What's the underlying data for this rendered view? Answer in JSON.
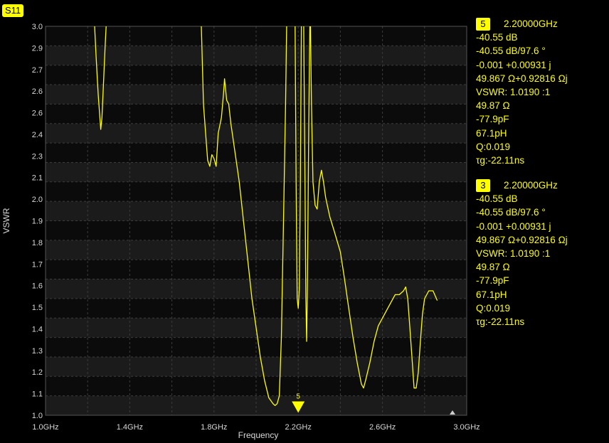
{
  "trace_label": "S11",
  "colors": {
    "trace": "#ffff00",
    "band_light": "#1b1b1b",
    "band_dark": "#0b0b0b",
    "grid": "#3c3c3c",
    "axis_text": "#d8d8d8"
  },
  "chart_data": {
    "type": "line",
    "title": "",
    "xlabel": "Frequency",
    "ylabel": "VSWR",
    "xlim": [
      1.0,
      3.0
    ],
    "ylim": [
      1.0,
      3.0
    ],
    "x_ticks": [
      {
        "v": 1.0,
        "label": "1.0GHz"
      },
      {
        "v": 1.4,
        "label": "1.4GHz"
      },
      {
        "v": 1.8,
        "label": "1.8GHz"
      },
      {
        "v": 2.2,
        "label": "2.2GHz"
      },
      {
        "v": 2.6,
        "label": "2.6GHz"
      },
      {
        "v": 3.0,
        "label": "3.0GHz"
      }
    ],
    "y_ticks": [
      {
        "v": 1.0,
        "label": "1.0"
      },
      {
        "v": 1.1,
        "label": "1.1"
      },
      {
        "v": 1.2,
        "label": "1.2"
      },
      {
        "v": 1.3,
        "label": "1.3"
      },
      {
        "v": 1.4,
        "label": "1.4"
      },
      {
        "v": 1.5,
        "label": "1.5"
      },
      {
        "v": 1.6,
        "label": "1.6"
      },
      {
        "v": 1.7,
        "label": "1.7"
      },
      {
        "v": 1.8,
        "label": "1.8"
      },
      {
        "v": 1.9,
        "label": "1.9"
      },
      {
        "v": 2.0,
        "label": "2.0"
      },
      {
        "v": 2.1,
        "label": "2.1"
      },
      {
        "v": 2.2,
        "label": "2.3"
      },
      {
        "v": 2.3,
        "label": "2.4"
      },
      {
        "v": 2.4,
        "label": "2.6"
      },
      {
        "v": 2.5,
        "label": "2.6"
      },
      {
        "v": 2.6,
        "label": "2.7"
      },
      {
        "v": 2.7,
        "label": "2.9"
      },
      {
        "v": 2.8,
        "label": "3.0"
      }
    ],
    "grid": true,
    "series": [
      {
        "segments": [
          [
            [
              1.233,
              3.0
            ],
            [
              1.24,
              2.85
            ],
            [
              1.25,
              2.65
            ],
            [
              1.258,
              2.53
            ],
            [
              1.262,
              2.47
            ],
            [
              1.268,
              2.53
            ],
            [
              1.275,
              2.7
            ],
            [
              1.283,
              2.9
            ],
            [
              1.288,
              3.0
            ]
          ],
          [
            [
              1.74,
              3.0
            ],
            [
              1.745,
              2.8
            ],
            [
              1.75,
              2.6
            ],
            [
              1.76,
              2.45
            ],
            [
              1.77,
              2.31
            ],
            [
              1.78,
              2.28
            ],
            [
              1.79,
              2.34
            ],
            [
              1.8,
              2.32
            ],
            [
              1.81,
              2.28
            ],
            [
              1.82,
              2.45
            ],
            [
              1.835,
              2.53
            ],
            [
              1.845,
              2.65
            ],
            [
              1.85,
              2.73
            ],
            [
              1.86,
              2.62
            ],
            [
              1.87,
              2.6
            ],
            [
              1.88,
              2.5
            ],
            [
              1.9,
              2.35
            ],
            [
              1.92,
              2.2
            ],
            [
              1.94,
              2.0
            ],
            [
              1.96,
              1.8
            ],
            [
              1.98,
              1.6
            ],
            [
              2.0,
              1.45
            ],
            [
              2.02,
              1.3
            ],
            [
              2.04,
              1.18
            ],
            [
              2.06,
              1.09
            ],
            [
              2.08,
              1.06
            ],
            [
              2.09,
              1.05
            ],
            [
              2.1,
              1.06
            ],
            [
              2.11,
              1.1
            ],
            [
              2.12,
              1.4
            ],
            [
              2.13,
              2.0
            ],
            [
              2.14,
              2.6
            ],
            [
              2.145,
              3.0
            ]
          ],
          [
            [
              2.185,
              3.0
            ],
            [
              2.19,
              2.2
            ],
            [
              2.195,
              1.6
            ],
            [
              2.2,
              1.55
            ],
            [
              2.205,
              1.65
            ],
            [
              2.21,
              2.2
            ],
            [
              2.215,
              3.0
            ]
          ],
          [
            [
              2.226,
              3.0
            ],
            [
              2.232,
              2.2
            ],
            [
              2.236,
              1.6
            ],
            [
              2.24,
              1.38
            ],
            [
              2.244,
              1.7
            ],
            [
              2.25,
              2.5
            ],
            [
              2.255,
              3.0
            ]
          ],
          [
            [
              2.258,
              3.0
            ],
            [
              2.263,
              2.6
            ],
            [
              2.27,
              2.2
            ],
            [
              2.28,
              2.08
            ],
            [
              2.29,
              2.06
            ],
            [
              2.3,
              2.2
            ],
            [
              2.31,
              2.26
            ],
            [
              2.32,
              2.2
            ],
            [
              2.33,
              2.12
            ],
            [
              2.35,
              2.02
            ],
            [
              2.37,
              1.95
            ],
            [
              2.4,
              1.84
            ],
            [
              2.42,
              1.7
            ],
            [
              2.44,
              1.55
            ],
            [
              2.46,
              1.4
            ],
            [
              2.48,
              1.27
            ],
            [
              2.5,
              1.16
            ],
            [
              2.51,
              1.14
            ],
            [
              2.52,
              1.18
            ],
            [
              2.54,
              1.27
            ],
            [
              2.56,
              1.38
            ],
            [
              2.58,
              1.46
            ],
            [
              2.6,
              1.5
            ],
            [
              2.62,
              1.54
            ],
            [
              2.64,
              1.58
            ],
            [
              2.66,
              1.62
            ],
            [
              2.68,
              1.62
            ],
            [
              2.7,
              1.64
            ],
            [
              2.71,
              1.66
            ],
            [
              2.72,
              1.6
            ],
            [
              2.73,
              1.45
            ],
            [
              2.74,
              1.3
            ],
            [
              2.75,
              1.14
            ],
            [
              2.76,
              1.14
            ],
            [
              2.77,
              1.22
            ],
            [
              2.78,
              1.38
            ],
            [
              2.79,
              1.52
            ],
            [
              2.8,
              1.6
            ],
            [
              2.82,
              1.64
            ],
            [
              2.84,
              1.64
            ],
            [
              2.86,
              1.59
            ]
          ]
        ]
      }
    ],
    "markers": [
      {
        "id": "5",
        "x": 2.2,
        "y": 1.02
      }
    ]
  },
  "markers_panel": [
    {
      "number": "5",
      "freq": "2.20000GHz",
      "lines": [
        "-40.55 dB",
        "-40.55 dB/97.6 °",
        "-0.001 +0.00931 j",
        "49.867 Ω+0.92816 Ωj",
        "VSWR: 1.0190 :1",
        "49.87 Ω",
        "-77.9pF",
        "67.1pH",
        "Q:0.019",
        "τg:-22.11ns"
      ]
    },
    {
      "number": "3",
      "freq": "2.20000GHz",
      "lines": [
        "-40.55 dB",
        "-40.55 dB/97.6 °",
        "-0.001 +0.00931 j",
        "49.867 Ω+0.92816 Ωj",
        "VSWR: 1.0190 :1",
        "49.87 Ω",
        "-77.9pF",
        "67.1pH",
        "Q:0.019",
        "τg:-22.11ns"
      ]
    }
  ]
}
